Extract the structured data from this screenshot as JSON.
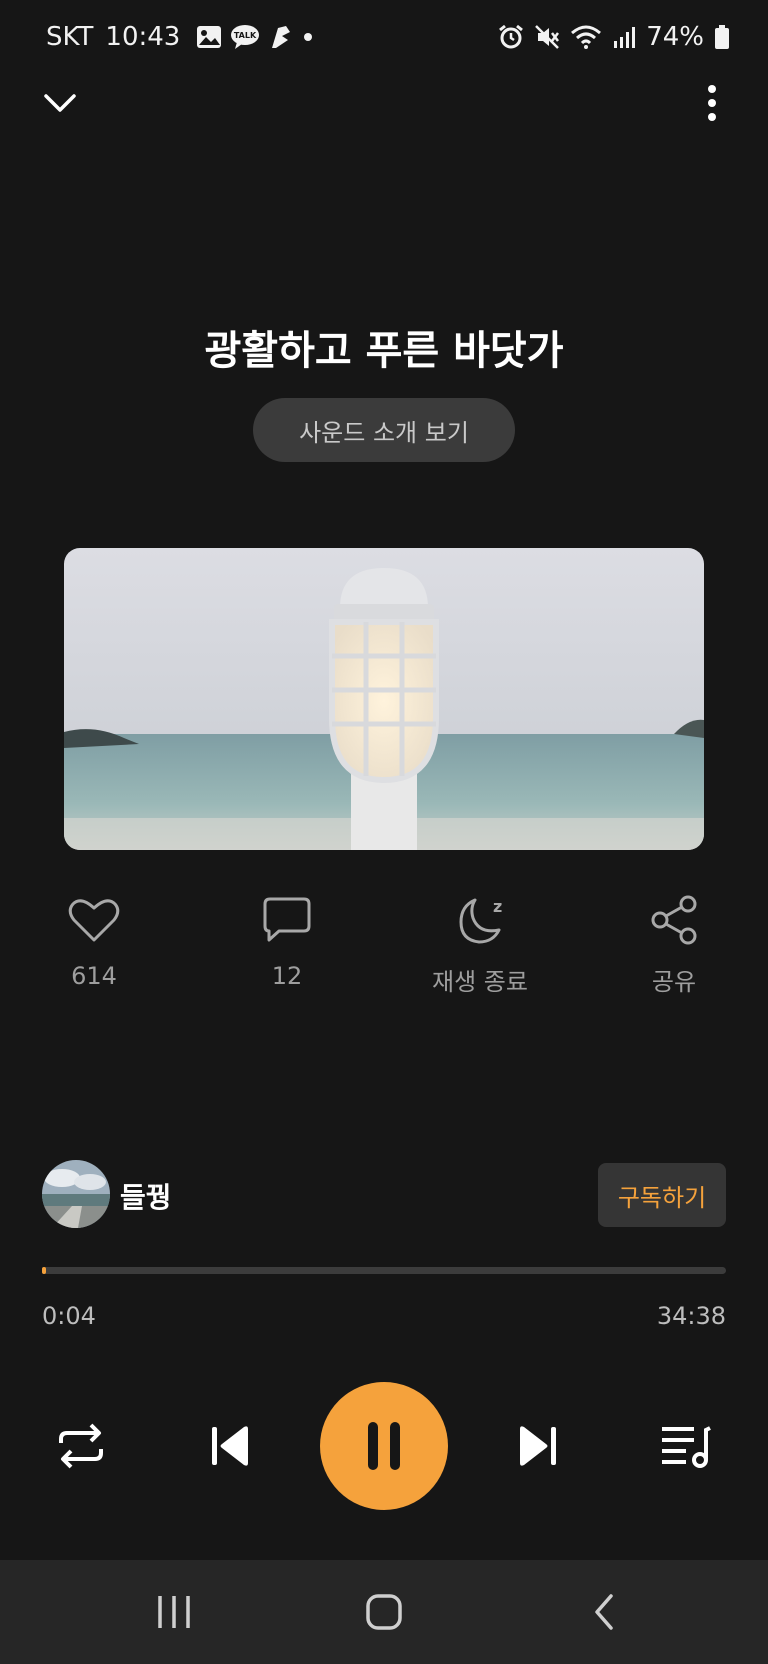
{
  "status_bar": {
    "carrier": "SKT",
    "time": "10:43",
    "notification_icons": [
      "gallery-icon",
      "kakaotalk-icon",
      "app-icon",
      "dot-icon"
    ],
    "system_icons": [
      "alarm-icon",
      "mute-icon",
      "wifi-icon",
      "signal-icon"
    ],
    "battery": "74%"
  },
  "player": {
    "title": "광활하고 푸른 바닷가",
    "intro_button_label": "사운드 소개 보기"
  },
  "actions": {
    "like_count": "614",
    "comment_count": "12",
    "sleep_timer_label": "재생 종료",
    "share_label": "공유"
  },
  "channel": {
    "name": "들꿩",
    "subscribe_label": "구독하기"
  },
  "progress": {
    "current": "0:04",
    "total": "34:38",
    "fraction": 0.002
  },
  "colors": {
    "accent": "#f5a23c",
    "background": "#161616"
  }
}
